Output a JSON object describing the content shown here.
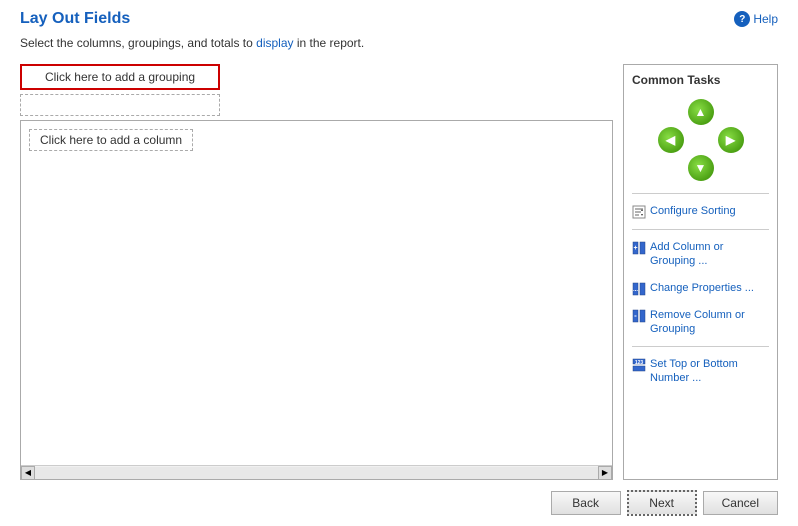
{
  "header": {
    "title": "Lay Out Fields",
    "help_label": "Help"
  },
  "subtitle": {
    "text_before": "Select the columns, groupings, and totals to ",
    "link_text": "display",
    "text_after": " in the report."
  },
  "layout": {
    "grouping_label": "Click here to add a grouping",
    "column_label": "Click here to add a column"
  },
  "common_tasks": {
    "title": "Common Tasks",
    "items": [
      {
        "id": "configure-sorting",
        "label": "Configure Sorting",
        "icon": "sort-icon"
      },
      {
        "id": "add-column",
        "label": "Add Column or Grouping ...",
        "icon": "grid-icon"
      },
      {
        "id": "change-properties",
        "label": "Change Properties ...",
        "icon": "grid-icon"
      },
      {
        "id": "remove-column",
        "label": "Remove Column or Grouping",
        "icon": "grid-icon"
      },
      {
        "id": "set-top-bottom",
        "label": "Set Top or Bottom Number ...",
        "icon": "grid-icon"
      }
    ]
  },
  "footer": {
    "back_label": "Back",
    "next_label": "Next",
    "cancel_label": "Cancel"
  },
  "arrows": {
    "up": "▲",
    "down": "▼",
    "left": "◄",
    "right": "►"
  }
}
